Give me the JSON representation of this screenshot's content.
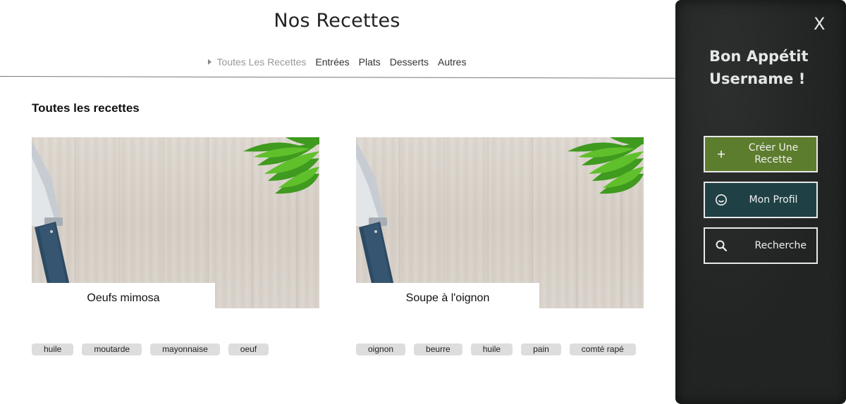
{
  "header": {
    "title": "Nos Recettes",
    "nav": [
      {
        "label": "Toutes Les Recettes",
        "active": true
      },
      {
        "label": "Entrées"
      },
      {
        "label": "Plats"
      },
      {
        "label": "Desserts"
      },
      {
        "label": "Autres"
      }
    ]
  },
  "section": {
    "title": "Toutes les recettes"
  },
  "recipes": [
    {
      "name": "Oeufs mimosa",
      "tags": [
        "huile",
        "moutarde",
        "mayonnaise",
        "oeuf"
      ]
    },
    {
      "name": "Soupe à l'oignon",
      "tags": [
        "oignon",
        "beurre",
        "huile",
        "pain",
        "comté rapé"
      ]
    }
  ],
  "sidebar": {
    "close_label": "X",
    "greeting_line1": "Bon Appétit",
    "greeting_line2": "Username !",
    "buttons": [
      {
        "label": "Créer Une Recette",
        "icon": "plus-icon",
        "color": "#5d7d2e"
      },
      {
        "label": "Mon Profil",
        "icon": "smiley-icon",
        "color": "#1f4145"
      },
      {
        "label": "Recherche",
        "icon": "search-icon"
      }
    ]
  },
  "colors": {
    "panel_bg": "#1f2121",
    "create_button": "#5d7d2e",
    "profile_button": "#1f4145",
    "tag_bg": "#dddddd"
  }
}
